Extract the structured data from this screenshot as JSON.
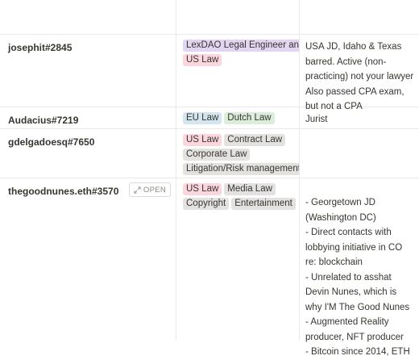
{
  "rows": [
    {
      "name": "",
      "tags": [],
      "notes": ""
    },
    {
      "name": "josephit#2845",
      "tags": [
        {
          "label": "LexDAO Legal Engineer and tie",
          "color": "#e2d5f2"
        },
        {
          "label": "US Law",
          "color": "#fbd6df"
        }
      ],
      "notes": "USA JD, Idaho & Texas barred. Active (non-practicing) not your lawyer Also passed CPA exam, but not a CPA"
    },
    {
      "name": "Audacius#7219",
      "tags": [
        {
          "label": "EU Law",
          "color": "#d3e5ef"
        },
        {
          "label": "Dutch Law",
          "color": "#dbeddb"
        }
      ],
      "notes": "Jurist"
    },
    {
      "name": "gdelgadoesq#7650",
      "tags": [
        {
          "label": "US Law",
          "color": "#fbd6df"
        },
        {
          "label": "Contract Law",
          "color": "#e3e2e0"
        },
        {
          "label": "Corporate Law",
          "color": "#e3e2e0"
        },
        {
          "label": "Litigation/Risk management",
          "color": "#e3e2e0"
        }
      ],
      "notes": ""
    },
    {
      "name": "thegoodnunes.eth#3570",
      "open_label": "OPEN",
      "tags": [
        {
          "label": "US Law",
          "color": "#fbd6df"
        },
        {
          "label": "Media Law",
          "color": "#e3e2e0"
        },
        {
          "label": "Copyright",
          "color": "#e3e2e0"
        },
        {
          "label": "Entertainment",
          "color": "#e3e2e0"
        }
      ],
      "notes_lines": [
        "- Georgetown JD (Washington DC)",
        "- Direct contacts with lobbying initiative in CO re: blockchain",
        "- Unrelated to asshat Devin Nunes, which is why I'M The Good Nunes",
        "- Augmented Reality producer, NFT producer",
        "- Bitcoin since 2014, ETH"
      ]
    }
  ]
}
